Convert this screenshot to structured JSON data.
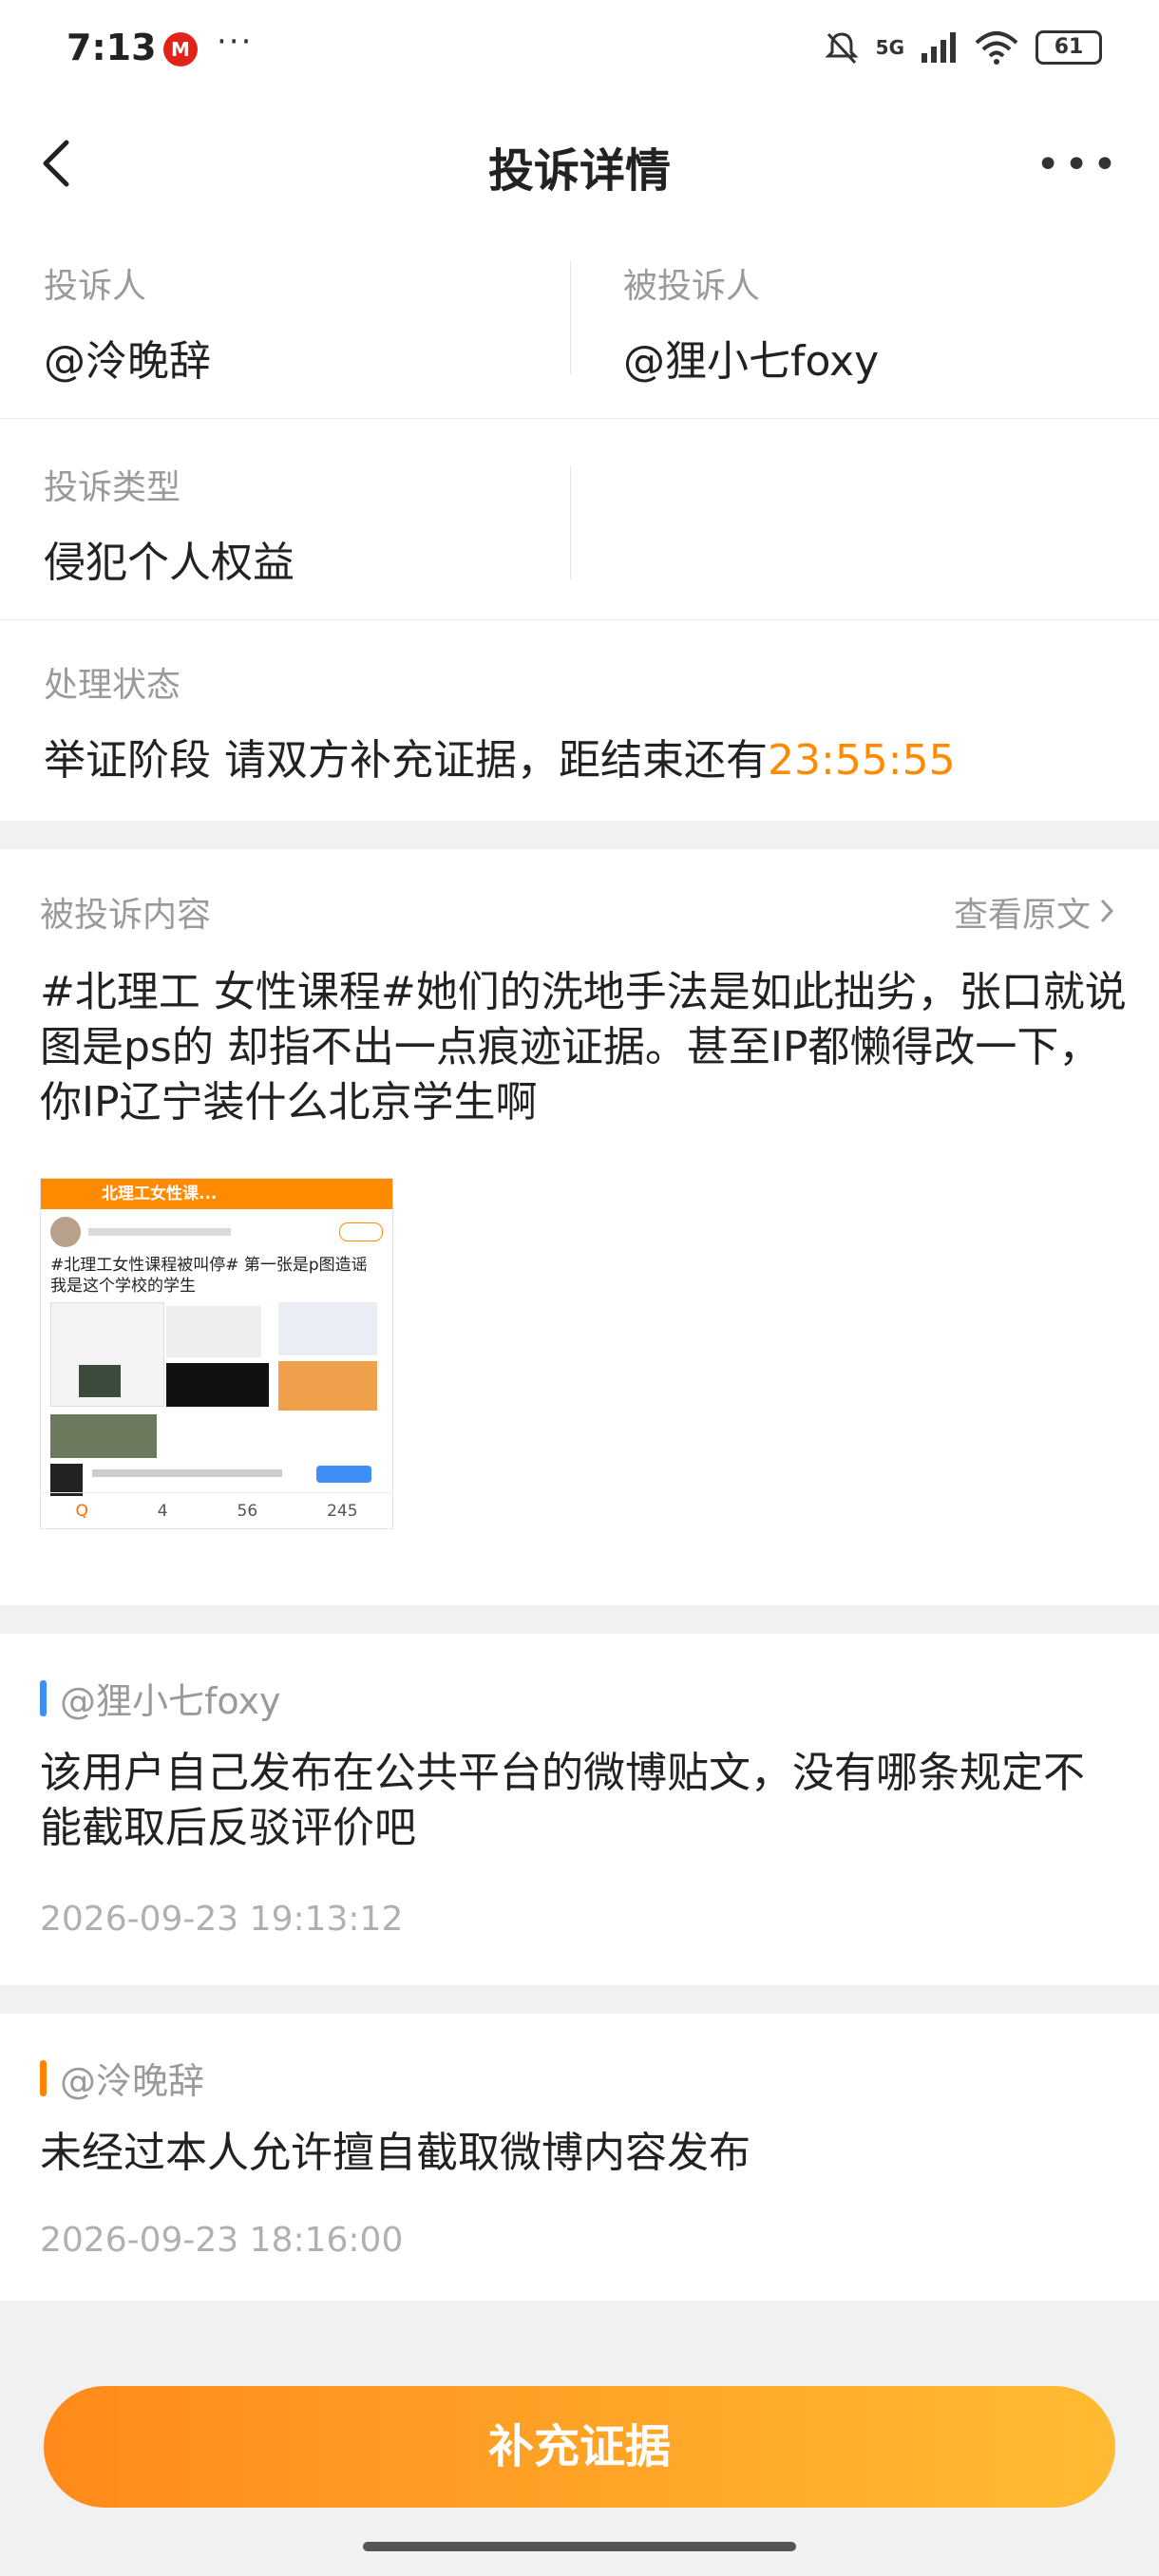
{
  "status": {
    "time": "7:13",
    "network": "5G",
    "battery": "61"
  },
  "nav": {
    "title": "投诉详情"
  },
  "complainant": {
    "label": "投诉人",
    "value": "@泠晚辞"
  },
  "respondent": {
    "label": "被投诉人",
    "value": "@狸小七foxy"
  },
  "type": {
    "label": "投诉类型",
    "value": "侵犯个人权益"
  },
  "state": {
    "label": "处理状态",
    "text": "举证阶段 请双方补充证据，距结束还有",
    "countdown": "23:55:55"
  },
  "complained": {
    "label": "被投诉内容",
    "view_original": "查看原文",
    "text": "#北理工 女性课程#她们的洗地手法是如此拙劣，张口就说图是ps的 却指不出一点痕迹证据。甚至IP都懒得改一下，你IP辽宁装什么北京学生啊",
    "thumb": {
      "title": "北理工女性课...",
      "headline": "#北理工女性课程被叫停# 第一张是p图造谣 我是这个学校的学生",
      "stats": [
        "4",
        "56",
        "245"
      ]
    }
  },
  "replies": [
    {
      "author": "@狸小七foxy",
      "text": "该用户自己发布在公共平台的微博贴文，没有哪条规定不能截取后反驳评价吧",
      "time": "2026-09-23 19:13:12",
      "color": "#3d8ef5"
    },
    {
      "author": "@泠晚辞",
      "text": "未经过本人允许擅自截取微博内容发布",
      "time": "2026-09-23 18:16:00",
      "color": "#ff8200"
    }
  ],
  "action": {
    "label": "补充证据"
  }
}
